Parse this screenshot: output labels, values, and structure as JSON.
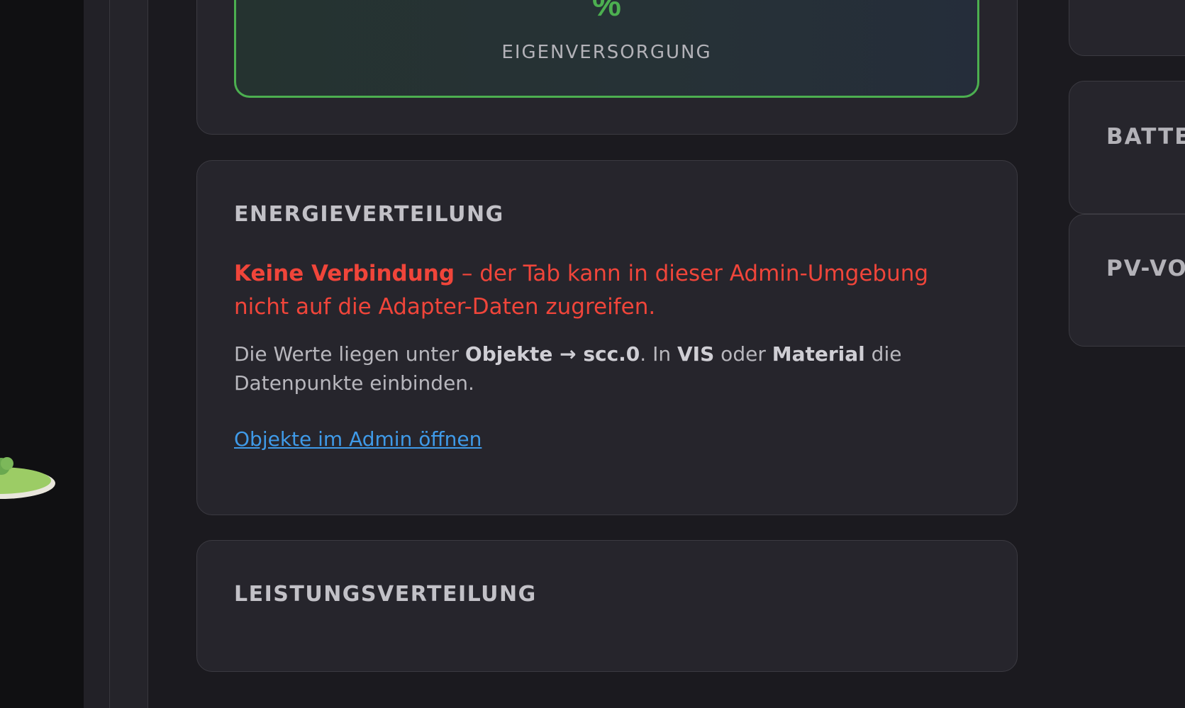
{
  "self_supply": {
    "unit": "%",
    "label": "EIGENVERSORGUNG"
  },
  "energy_distribution": {
    "title": "ENERGIEVERTEILUNG",
    "error_strong": "Keine Verbindung",
    "error_rest": " – der Tab kann in dieser Admin-Umgebung nicht auf die Adapter-Daten zugreifen.",
    "info_1": "Die Werte liegen unter ",
    "info_objects": "Objekte",
    "info_arrow": " → ",
    "info_path": "scc.0",
    "info_2": ". In ",
    "info_vis": "VIS",
    "info_3": " oder ",
    "info_material": "Material",
    "info_4": " die Datenpunkte einbinden.",
    "link_label": "Objekte im Admin öffnen"
  },
  "power_distribution": {
    "title": "LEISTUNGSVERTEILUNG"
  },
  "side_panels": [
    {
      "title": ""
    },
    {
      "title": "BATTERIE"
    },
    {
      "title": "PV-VORHERSAGE"
    }
  ],
  "colors": {
    "accent_green": "#4caf50",
    "error_red": "#f0453a",
    "link_blue": "#3f9ae8",
    "card_bg": "#26252c",
    "page_bg": "#1b1a1f"
  }
}
